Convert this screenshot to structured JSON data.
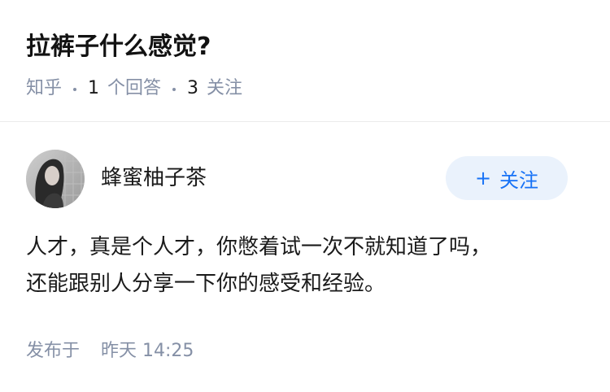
{
  "question": {
    "title": "拉裤子什么感觉?",
    "source": "知乎",
    "answer_count": "1",
    "answer_label": "个回答",
    "follower_count": "3",
    "follower_label": "关注"
  },
  "answer": {
    "author": {
      "name": "蜂蜜柚子茶"
    },
    "follow_button": {
      "icon": "+",
      "label": "关注"
    },
    "content_lines": [
      "人才，真是个人才，你憋着试一次不就知道了吗，",
      "还能跟别人分享一下你的感受和经验。"
    ],
    "published_label": "发布于",
    "published_time": "昨天 14:25"
  },
  "colors": {
    "meta_gray": "#8590a6",
    "accent_blue": "#1772f6",
    "follow_bg": "#eaf2fc"
  }
}
